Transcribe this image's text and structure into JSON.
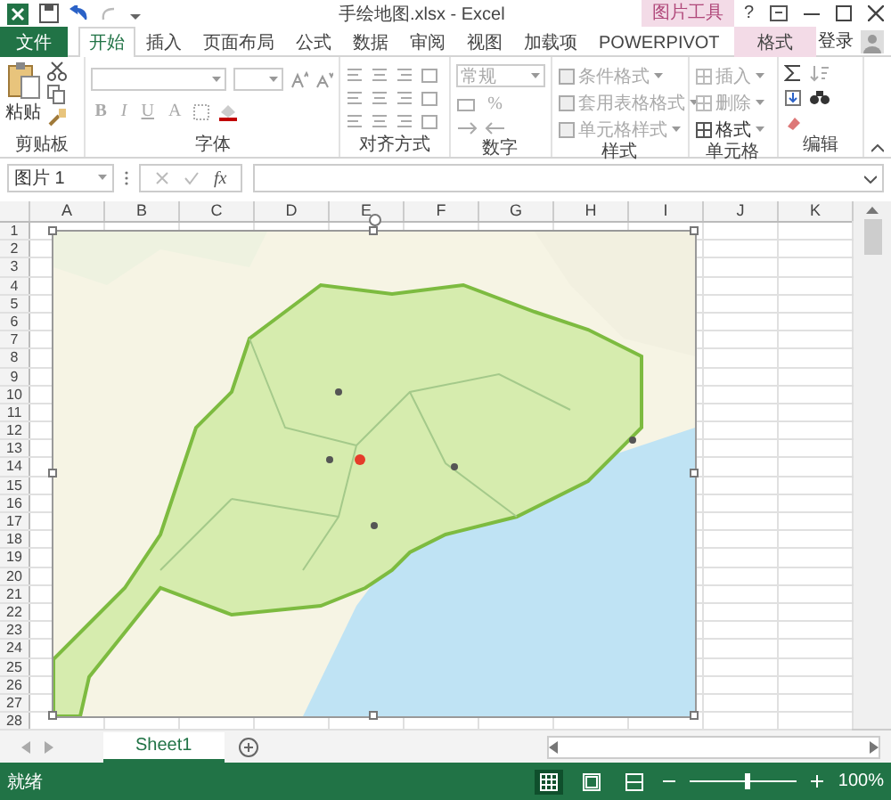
{
  "window": {
    "title": "手绘地图.xlsx - Excel",
    "context_label": "图片工具",
    "help": "?"
  },
  "tabs": [
    {
      "label": "文件",
      "kind": "file",
      "selected": false
    },
    {
      "label": "开始",
      "kind": "tab",
      "selected": true
    },
    {
      "label": "插入",
      "kind": "tab",
      "selected": false
    },
    {
      "label": "页面布局",
      "kind": "tab",
      "selected": false
    },
    {
      "label": "公式",
      "kind": "tab",
      "selected": false
    },
    {
      "label": "数据",
      "kind": "tab",
      "selected": false
    },
    {
      "label": "审阅",
      "kind": "tab",
      "selected": false
    },
    {
      "label": "视图",
      "kind": "tab",
      "selected": false
    },
    {
      "label": "加载项",
      "kind": "tab",
      "selected": false
    },
    {
      "label": "POWERPIVOT",
      "kind": "tab",
      "selected": false
    },
    {
      "label": "格式",
      "kind": "context",
      "selected": false
    }
  ],
  "account": "登录",
  "ribbon": {
    "groups": [
      {
        "kind": "clipboard",
        "label": "剪贴板",
        "paste": "粘贴"
      },
      {
        "kind": "font",
        "label": "字体",
        "buttons": [
          {
            "label": "B",
            "disabled": true
          },
          {
            "label": "I",
            "disabled": true
          },
          {
            "label": "U",
            "disabled": true
          },
          {
            "label": "A",
            "disabled": true
          }
        ]
      },
      {
        "kind": "alignment",
        "label": "对齐方式"
      },
      {
        "kind": "number",
        "label": "数字",
        "format": "常规",
        "buttons": [
          {
            "label": "%",
            "disabled": true
          }
        ]
      },
      {
        "kind": "styles",
        "label": "样式",
        "items": [
          {
            "label": "条件格式",
            "disabled": true
          },
          {
            "label": "套用表格格式",
            "disabled": true
          },
          {
            "label": "单元格样式",
            "disabled": true
          }
        ]
      },
      {
        "kind": "cells",
        "label": "单元格",
        "items": [
          {
            "label": "插入",
            "disabled": true
          },
          {
            "label": "删除",
            "disabled": true
          },
          {
            "label": "格式",
            "disabled": false
          }
        ]
      },
      {
        "kind": "editing",
        "label": "编辑"
      }
    ]
  },
  "formula_bar": {
    "name_box": "图片 1",
    "function_label": "fx"
  },
  "sheet": {
    "columns": [
      "A",
      "B",
      "C",
      "D",
      "E",
      "F",
      "G",
      "H",
      "I",
      "J",
      "K"
    ],
    "rows": [
      "1",
      "2",
      "3",
      "4",
      "5",
      "6",
      "7",
      "8",
      "9",
      "10",
      "11",
      "12",
      "13",
      "14",
      "15",
      "16",
      "17",
      "18",
      "19",
      "20",
      "21",
      "22",
      "23",
      "24",
      "25",
      "26",
      "27",
      "28"
    ]
  },
  "sheet_tabs": [
    {
      "label": "Sheet1",
      "selected": true
    }
  ],
  "status_bar": {
    "status": "就绪",
    "views": [
      {
        "selected": true
      },
      {
        "selected": false
      },
      {
        "selected": false
      }
    ],
    "zoom": {
      "level": 0.52
    },
    "zoom_label": "100%"
  }
}
